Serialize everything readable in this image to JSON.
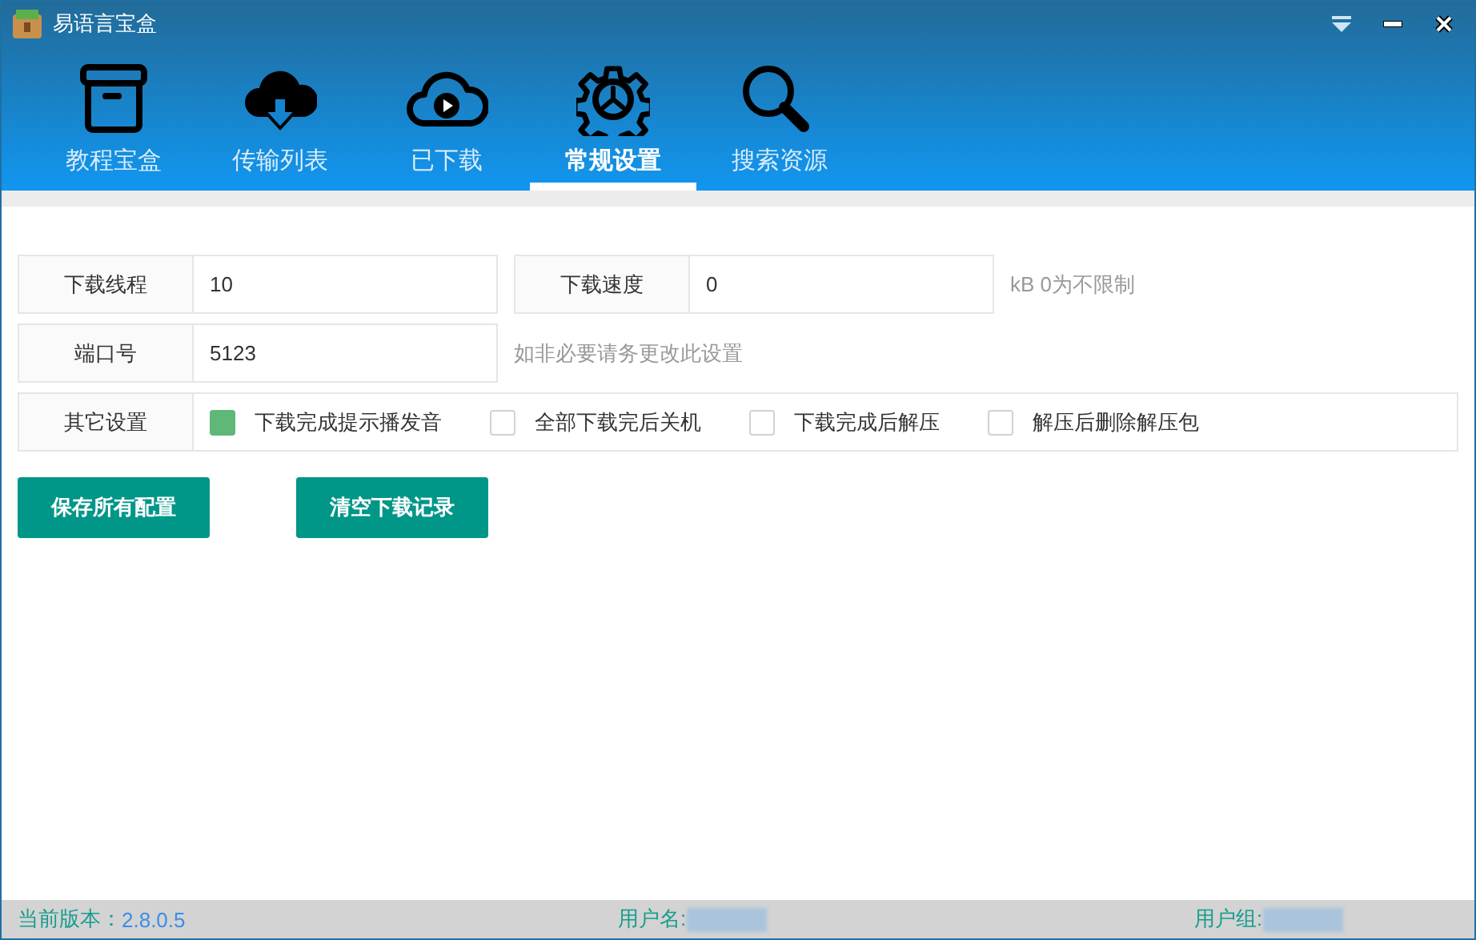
{
  "window": {
    "title": "易语言宝盒"
  },
  "tabs": [
    {
      "label": "教程宝盒",
      "selected": false
    },
    {
      "label": "传输列表",
      "selected": false
    },
    {
      "label": "已下载",
      "selected": false
    },
    {
      "label": "常规设置",
      "selected": true
    },
    {
      "label": "搜索资源",
      "selected": false
    }
  ],
  "settings": {
    "rows": [
      {
        "fields": [
          {
            "label": "下载线程",
            "value": "10"
          },
          {
            "label": "下载速度",
            "value": "0"
          }
        ],
        "hint": "kB 0为不限制"
      },
      {
        "fields": [
          {
            "label": "端口号",
            "value": "5123"
          }
        ],
        "hint": "如非必要请务更改此设置"
      }
    ],
    "other": {
      "label": "其它设置",
      "options": [
        {
          "label": "下载完成提示播发音",
          "checked": true
        },
        {
          "label": "全部下载完后关机",
          "checked": false
        },
        {
          "label": "下载完成后解压",
          "checked": false
        },
        {
          "label": "解压后删除解压包",
          "checked": false
        }
      ]
    }
  },
  "buttons": [
    "保存所有配置",
    "清空下载记录"
  ],
  "status_bar": {
    "version_label": "当前版本：",
    "version": "2.8.0.5",
    "user_label": "用户名:",
    "group_label": "用户组:"
  }
}
